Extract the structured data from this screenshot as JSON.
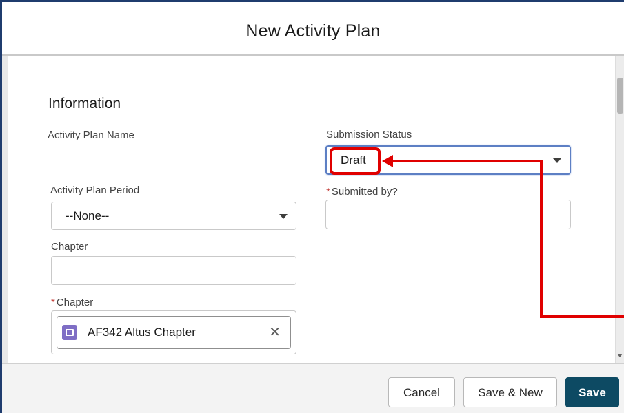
{
  "modal": {
    "title": "New Activity Plan"
  },
  "section": {
    "title": "Information"
  },
  "fields": {
    "activity_plan_name": {
      "label": "Activity Plan Name"
    },
    "submission_status": {
      "label": "Submission Status",
      "value": "Draft"
    },
    "activity_plan_period": {
      "label": "Activity Plan Period",
      "value": "--None--"
    },
    "submitted_by": {
      "label": "Submitted by?",
      "required_mark": "*",
      "value": ""
    },
    "chapter_text": {
      "label": "Chapter",
      "value": ""
    },
    "chapter_lookup": {
      "label": "Chapter",
      "required_mark": "*",
      "selected": "AF342 Altus Chapter",
      "clear_glyph": "✕"
    }
  },
  "footer": {
    "cancel_label": "Cancel",
    "save_new_label": "Save & New",
    "save_label": "Save"
  },
  "colors": {
    "annotation_red": "#e00000",
    "brand_button": "#0d4a63",
    "focus_border": "#5d7fc4",
    "lookup_icon": "#7f6ec5",
    "required": "#c23934"
  },
  "icons": {
    "dropdown": "chevron-down-icon",
    "lookup_record": "record-icon",
    "clear": "close-icon"
  }
}
